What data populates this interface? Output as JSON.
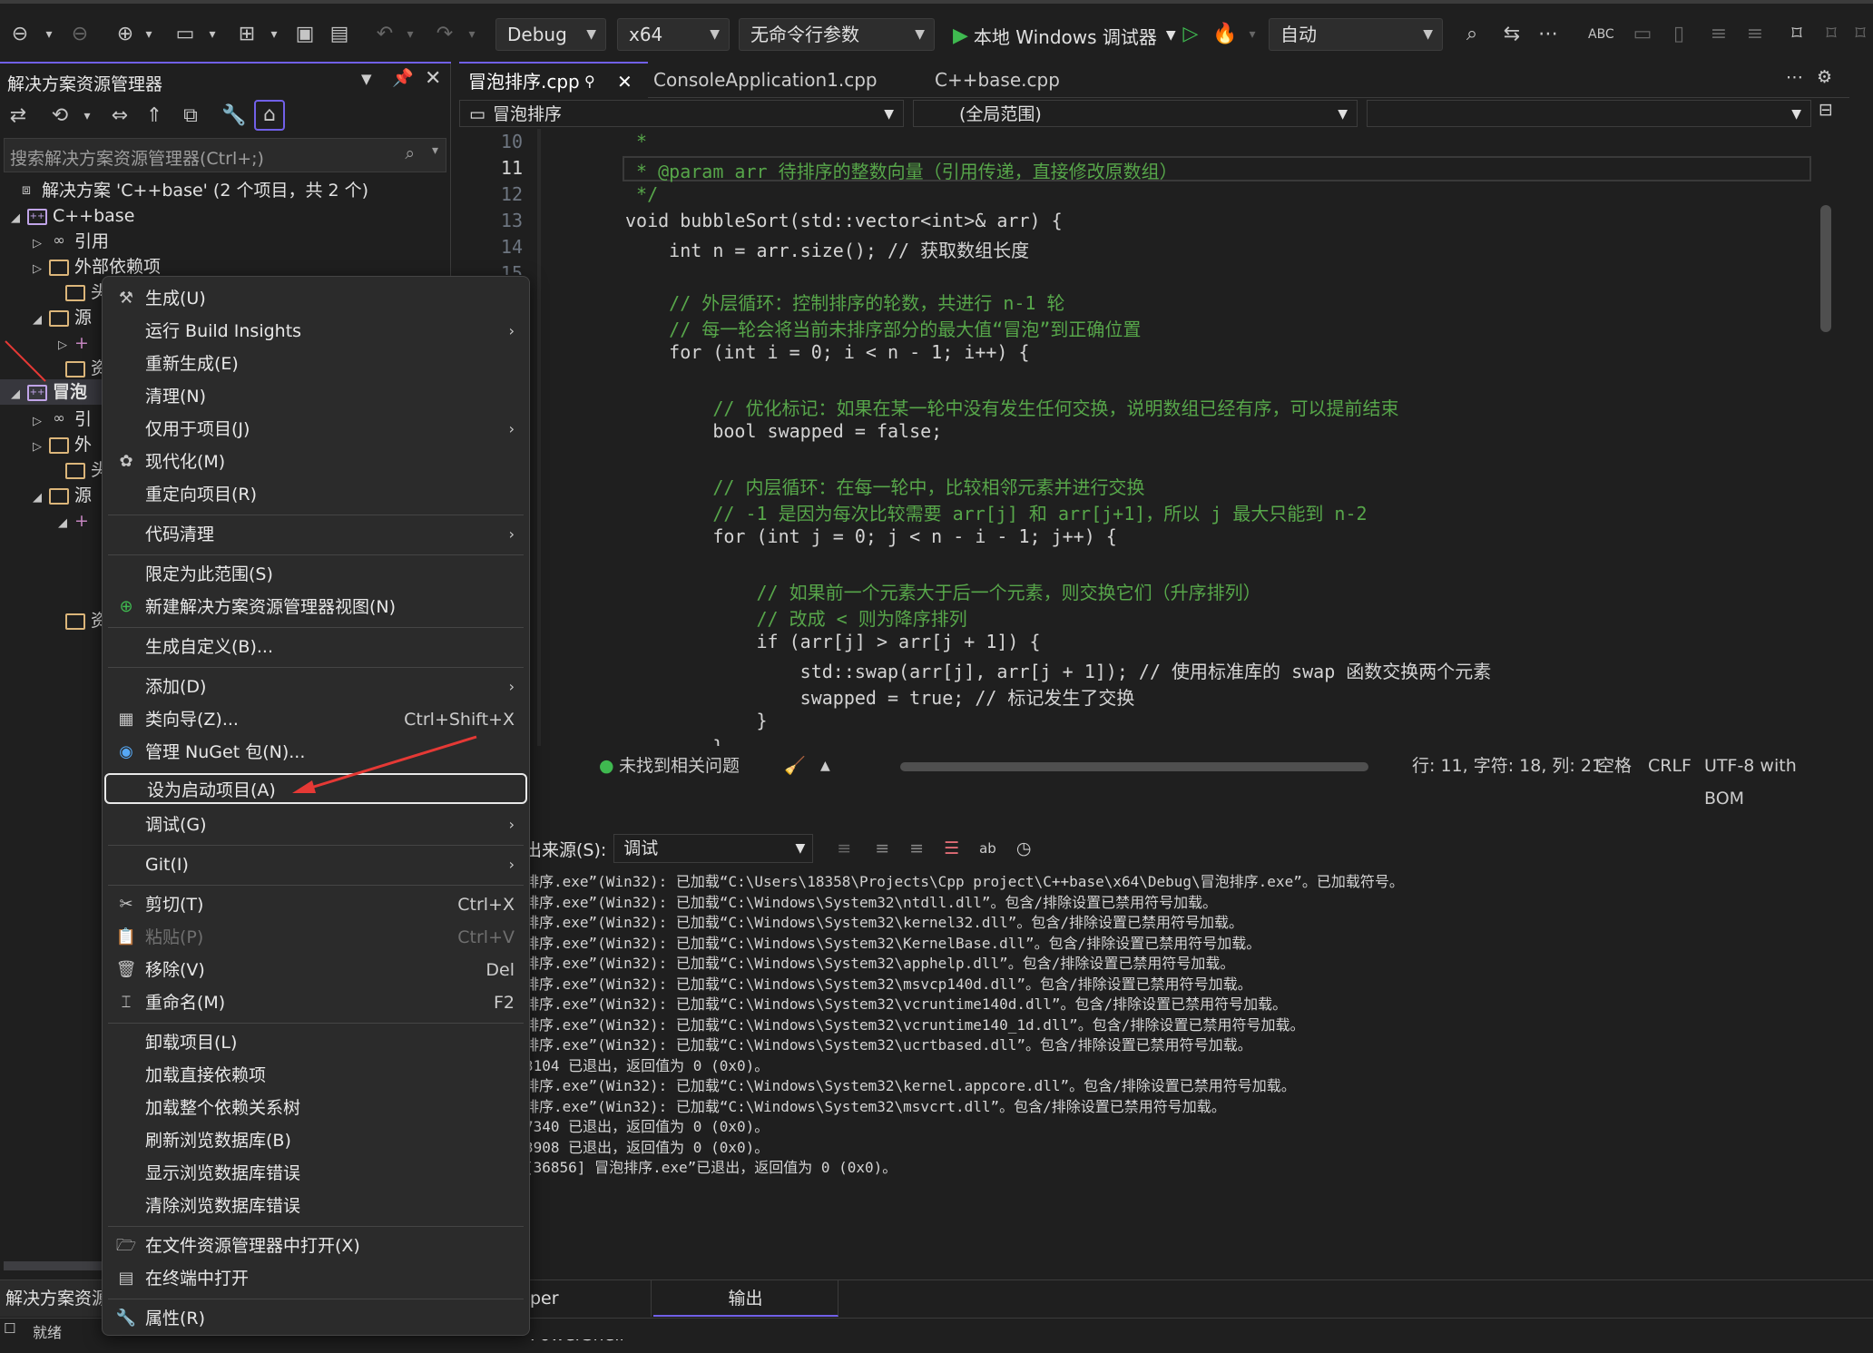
{
  "toolbar": {
    "config": "Debug",
    "platform": "x64",
    "args": "无命令行参数",
    "debugger": "本地 Windows 调试器",
    "mode": "自动"
  },
  "solution_explorer": {
    "title": "解决方案资源管理器",
    "search_placeholder": "搜索解决方案资源管理器(Ctrl+;)",
    "items": [
      {
        "label": "解决方案 'C++base' (2 个项目，共 2 个)"
      },
      {
        "label": "C++base"
      },
      {
        "label": "引用"
      },
      {
        "label": "外部依赖项"
      },
      {
        "label": "头"
      },
      {
        "label": "源"
      },
      {
        "label": "+"
      },
      {
        "label": "资"
      },
      {
        "label": "冒泡"
      },
      {
        "label": "引"
      },
      {
        "label": "外"
      },
      {
        "label": "头"
      },
      {
        "label": "源"
      },
      {
        "label": "+"
      },
      {
        "label": "资"
      }
    ],
    "bottom_tab": "解决方案资源"
  },
  "editor": {
    "tabs": [
      {
        "label": "冒泡排序.cpp"
      },
      {
        "label": "ConsoleApplication1.cpp"
      },
      {
        "label": "C++base.cpp"
      }
    ],
    "nav_file": "冒泡排序",
    "nav_scope": "(全局范围)",
    "lines": [
      {
        "n": "10",
        "t": " *"
      },
      {
        "n": "11",
        "t": " * @param arr 待排序的整数向量（引用传递，直接修改原数组）"
      },
      {
        "n": "12",
        "t": " */"
      },
      {
        "n": "13",
        "t": "void bubbleSort(std::vector<int>& arr) {"
      },
      {
        "n": "14",
        "t": "    int n = arr.size(); // 获取数组长度"
      },
      {
        "n": "15",
        "t": ""
      },
      {
        "n": "",
        "t": "    // 外层循环：控制排序的轮数，共进行 n-1 轮"
      },
      {
        "n": "",
        "t": "    // 每一轮会将当前未排序部分的最大值“冒泡”到正确位置"
      },
      {
        "n": "",
        "t": "    for (int i = 0; i < n - 1; i++) {"
      },
      {
        "n": "",
        "t": ""
      },
      {
        "n": "",
        "t": "        // 优化标记：如果在某一轮中没有发生任何交换，说明数组已经有序，可以提前结束"
      },
      {
        "n": "",
        "t": "        bool swapped = false;"
      },
      {
        "n": "",
        "t": ""
      },
      {
        "n": "",
        "t": "        // 内层循环：在每一轮中，比较相邻元素并进行交换"
      },
      {
        "n": "",
        "t": "        // -1 是因为每次比较需要 arr[j] 和 arr[j+1]，所以 j 最大只能到 n-2"
      },
      {
        "n": "",
        "t": "        for (int j = 0; j < n - i - 1; j++) {"
      },
      {
        "n": "",
        "t": ""
      },
      {
        "n": "",
        "t": "            // 如果前一个元素大于后一个元素，则交换它们（升序排列）"
      },
      {
        "n": "",
        "t": "            // 改成 < 则为降序排列"
      },
      {
        "n": "",
        "t": "            if (arr[j] > arr[j + 1]) {"
      },
      {
        "n": "",
        "t": "                std::swap(arr[j], arr[j + 1]); // 使用标准库的 swap 函数交换两个元素"
      },
      {
        "n": "",
        "t": "                swapped = true; // 标记发生了交换"
      },
      {
        "n": "",
        "t": "            }"
      },
      {
        "n": "",
        "t": "        }"
      }
    ],
    "issues": "未找到相关问题",
    "position": "行: 11, 字符: 18, 列: 21",
    "indent": "空格",
    "eol": "CRLF",
    "encoding": "UTF-8 with BOM"
  },
  "output": {
    "source_label": "出来源(S):",
    "source_value": "调试",
    "lines": [
      "排序.exe”(Win32): 已加载“C:\\Users\\18358\\Projects\\Cpp project\\C++base\\x64\\Debug\\冒泡排序.exe”。已加载符号。",
      "排序.exe”(Win32): 已加载“C:\\Windows\\System32\\ntdll.dll”。包含/排除设置已禁用符号加载。",
      "排序.exe”(Win32): 已加载“C:\\Windows\\System32\\kernel32.dll”。包含/排除设置已禁用符号加载。",
      "排序.exe”(Win32): 已加载“C:\\Windows\\System32\\KernelBase.dll”。包含/排除设置已禁用符号加载。",
      "排序.exe”(Win32): 已加载“C:\\Windows\\System32\\apphelp.dll”。包含/排除设置已禁用符号加载。",
      "排序.exe”(Win32): 已加载“C:\\Windows\\System32\\msvcp140d.dll”。包含/排除设置已禁用符号加载。",
      "排序.exe”(Win32): 已加载“C:\\Windows\\System32\\vcruntime140d.dll”。包含/排除设置已禁用符号加载。",
      "排序.exe”(Win32): 已加载“C:\\Windows\\System32\\vcruntime140_1d.dll”。包含/排除设置已禁用符号加载。",
      "排序.exe”(Win32): 已加载“C:\\Windows\\System32\\ucrtbased.dll”。包含/排除设置已禁用符号加载。",
      "3104 已退出，返回值为 0 (0x0)。",
      "排序.exe”(Win32): 已加载“C:\\Windows\\System32\\kernel.appcore.dll”。包含/排除设置已禁用符号加载。",
      "排序.exe”(Win32): 已加载“C:\\Windows\\System32\\msvcrt.dll”。包含/排除设置已禁用符号加载。",
      "7340 已退出，返回值为 0 (0x0)。",
      "3908 已退出，返回值为 0 (0x0)。",
      "[36856] 冒泡排序.exe”已退出，返回值为 0 (0x0)。"
    ],
    "tab_powershell": "per PowerShell",
    "tab_output": "输出"
  },
  "status": {
    "ready": "就绪"
  },
  "context_menu": {
    "items": [
      {
        "label": "生成(U)",
        "icon": "build-icon"
      },
      {
        "label": "运行 Build Insights",
        "submenu": true
      },
      {
        "label": "重新生成(E)"
      },
      {
        "label": "清理(N)"
      },
      {
        "label": "仅用于项目(J)",
        "submenu": true
      },
      {
        "label": "现代化(M)",
        "icon": "modernize-icon"
      },
      {
        "label": "重定向项目(R)"
      },
      {
        "label": "代码清理",
        "submenu": true
      },
      {
        "label": "限定为此范围(S)"
      },
      {
        "label": "新建解决方案资源管理器视图(N)",
        "icon": "new-view-icon"
      },
      {
        "label": "生成自定义(B)..."
      },
      {
        "label": "添加(D)",
        "submenu": true
      },
      {
        "label": "类向导(Z)...",
        "shortcut": "Ctrl+Shift+X",
        "icon": "class-wizard-icon"
      },
      {
        "label": "管理 NuGet 包(N)...",
        "icon": "nuget-icon"
      },
      {
        "label": "设为启动项目(A)",
        "highlighted": true
      },
      {
        "label": "调试(G)",
        "submenu": true
      },
      {
        "label": "Git(I)",
        "submenu": true
      },
      {
        "label": "剪切(T)",
        "shortcut": "Ctrl+X",
        "icon": "cut-icon"
      },
      {
        "label": "粘贴(P)",
        "shortcut": "Ctrl+V",
        "icon": "paste-icon",
        "disabled": true
      },
      {
        "label": "移除(V)",
        "shortcut": "Del",
        "icon": "delete-icon"
      },
      {
        "label": "重命名(M)",
        "shortcut": "F2",
        "icon": "rename-icon"
      },
      {
        "label": "卸载项目(L)"
      },
      {
        "label": "加载直接依赖项"
      },
      {
        "label": "加载整个依赖关系树"
      },
      {
        "label": "刷新浏览数据库(B)"
      },
      {
        "label": "显示浏览数据库错误"
      },
      {
        "label": "清除浏览数据库错误"
      },
      {
        "label": "在文件资源管理器中打开(X)",
        "icon": "folder-open-icon"
      },
      {
        "label": "在终端中打开",
        "icon": "terminal-icon"
      },
      {
        "label": "属性(R)",
        "icon": "wrench-icon"
      }
    ]
  },
  "colors": {
    "accent": "#7160e8",
    "annotation_arrow": "#e53935",
    "comment": "#57a64a",
    "keyword": "#569cd6"
  }
}
